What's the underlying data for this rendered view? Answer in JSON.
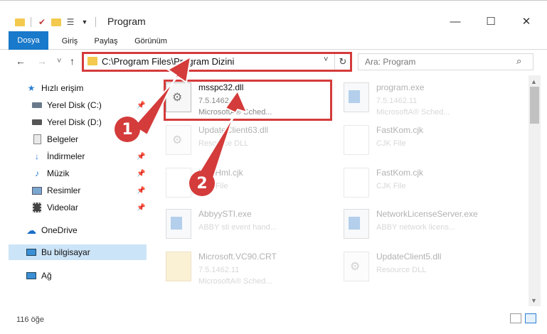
{
  "window": {
    "title": "Program",
    "minimize": "—",
    "maximize": "☐",
    "close": "✕"
  },
  "ribbon": {
    "tabs": [
      "Dosya",
      "Giriş",
      "Paylaş",
      "Görünüm"
    ]
  },
  "nav": {
    "back": "←",
    "forward": "→",
    "recent": "˅",
    "up": "↑",
    "address": "C:\\Program Files\\Program Dizini",
    "dropdown": "˅",
    "refresh": "↻",
    "search_placeholder": "Ara: Program",
    "search_icon": "⌕"
  },
  "sidebar": {
    "items": [
      {
        "label": "Hızlı erişim",
        "icon": "star-icon"
      },
      {
        "label": "Yerel Disk (C:)",
        "icon": "drive-icon"
      },
      {
        "label": "Yerel Disk (D:)",
        "icon": "drive-icon"
      },
      {
        "label": "Belgeler",
        "icon": "documents-icon"
      },
      {
        "label": "İndirmeler",
        "icon": "download-icon"
      },
      {
        "label": "Müzik",
        "icon": "music-icon"
      },
      {
        "label": "Resimler",
        "icon": "pictures-icon"
      },
      {
        "label": "Videolar",
        "icon": "videos-icon"
      },
      {
        "label": "OneDrive",
        "icon": "cloud-icon"
      },
      {
        "label": "Bu bilgisayar",
        "icon": "computer-icon"
      },
      {
        "label": "Ağ",
        "icon": "network-icon"
      }
    ]
  },
  "files": [
    {
      "name": "msspc32.dll",
      "line1": "7.5.1462.11",
      "line2": "MicrosoftA® Sched..."
    },
    {
      "name": "program.exe",
      "line1": "7.5.1462.11",
      "line2": "MicrosoftA® Sched..."
    },
    {
      "name": "UpdateClient63.dll",
      "line1": "Resource DLL",
      "line2": ""
    },
    {
      "name": "FastKom.cjk",
      "line1": "CJK File",
      "line2": ""
    },
    {
      "name": "FastHml.cjk",
      "line1": "CJK File",
      "line2": ""
    },
    {
      "name": "FastKom.cjk",
      "line1": "CJK File",
      "line2": ""
    },
    {
      "name": "AbbyySTI.exe",
      "line1": "ABBY sti event hand...",
      "line2": ""
    },
    {
      "name": "NetworkLicenseServer.exe",
      "line1": "ABBY network licens...",
      "line2": ""
    },
    {
      "name": "Microsoft.VC90.CRT",
      "line1": "7.5.1462.11",
      "line2": "MicrosoftA® Sched..."
    },
    {
      "name": "UpdateClient5.dll",
      "line1": "Resource DLL",
      "line2": ""
    }
  ],
  "status": {
    "count": "116 öğe"
  },
  "callouts": [
    "1",
    "2"
  ]
}
